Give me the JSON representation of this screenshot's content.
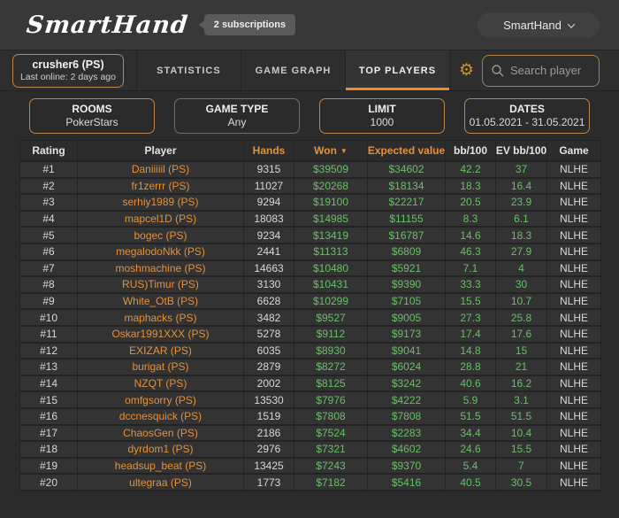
{
  "header": {
    "logo": "SmartHand",
    "subscriptions_badge": "2 subscriptions",
    "account_menu": "SmartHand"
  },
  "tabs": {
    "player_card": {
      "name": "crusher6 (PS)",
      "last_online": "Last online: 2 days ago"
    },
    "items": [
      {
        "label": "STATISTICS",
        "active": false
      },
      {
        "label": "GAME GRAPH",
        "active": false
      },
      {
        "label": "TOP PLAYERS",
        "active": true
      }
    ],
    "search_placeholder": "Search player"
  },
  "filters": [
    {
      "label": "ROOMS",
      "value": "PokerStars",
      "highlight": true
    },
    {
      "label": "GAME TYPE",
      "value": "Any",
      "highlight": false
    },
    {
      "label": "LIMIT",
      "value": "1000",
      "highlight": true
    },
    {
      "label": "DATES",
      "value": "01.05.2021 - 31.05.2021",
      "highlight": true
    }
  ],
  "table": {
    "columns": [
      "Rating",
      "Player",
      "Hands",
      "Won",
      "Expected value",
      "bb/100",
      "EV bb/100",
      "Game"
    ],
    "orange_columns": [
      "Hands",
      "Won",
      "Expected value"
    ],
    "sorted_column": "Won",
    "sort_direction": "desc",
    "rows": [
      {
        "rating": "#1",
        "player": "Daniiiiil (PS)",
        "hands": "9315",
        "won": "$39509",
        "expected_value": "$34602",
        "bb_100": "42.2",
        "ev_bb_100": "37",
        "game": "NLHE"
      },
      {
        "rating": "#2",
        "player": "fr1zerrr (PS)",
        "hands": "11027",
        "won": "$20268",
        "expected_value": "$18134",
        "bb_100": "18.3",
        "ev_bb_100": "16.4",
        "game": "NLHE"
      },
      {
        "rating": "#3",
        "player": "serhiy1989 (PS)",
        "hands": "9294",
        "won": "$19100",
        "expected_value": "$22217",
        "bb_100": "20.5",
        "ev_bb_100": "23.9",
        "game": "NLHE"
      },
      {
        "rating": "#4",
        "player": "mapcel1D (PS)",
        "hands": "18083",
        "won": "$14985",
        "expected_value": "$11155",
        "bb_100": "8.3",
        "ev_bb_100": "6.1",
        "game": "NLHE"
      },
      {
        "rating": "#5",
        "player": "bogec (PS)",
        "hands": "9234",
        "won": "$13419",
        "expected_value": "$16787",
        "bb_100": "14.6",
        "ev_bb_100": "18.3",
        "game": "NLHE"
      },
      {
        "rating": "#6",
        "player": "megalodoNkk (PS)",
        "hands": "2441",
        "won": "$11313",
        "expected_value": "$6809",
        "bb_100": "46.3",
        "ev_bb_100": "27.9",
        "game": "NLHE"
      },
      {
        "rating": "#7",
        "player": "moshmachine (PS)",
        "hands": "14663",
        "won": "$10480",
        "expected_value": "$5921",
        "bb_100": "7.1",
        "ev_bb_100": "4",
        "game": "NLHE"
      },
      {
        "rating": "#8",
        "player": "RUS)Timur (PS)",
        "hands": "3130",
        "won": "$10431",
        "expected_value": "$9390",
        "bb_100": "33.3",
        "ev_bb_100": "30",
        "game": "NLHE"
      },
      {
        "rating": "#9",
        "player": "White_OtB (PS)",
        "hands": "6628",
        "won": "$10299",
        "expected_value": "$7105",
        "bb_100": "15.5",
        "ev_bb_100": "10.7",
        "game": "NLHE"
      },
      {
        "rating": "#10",
        "player": "maphacks (PS)",
        "hands": "3482",
        "won": "$9527",
        "expected_value": "$9005",
        "bb_100": "27.3",
        "ev_bb_100": "25.8",
        "game": "NLHE"
      },
      {
        "rating": "#11",
        "player": "Oskar1991XXX (PS)",
        "hands": "5278",
        "won": "$9112",
        "expected_value": "$9173",
        "bb_100": "17.4",
        "ev_bb_100": "17.6",
        "game": "NLHE"
      },
      {
        "rating": "#12",
        "player": "EXIZAR (PS)",
        "hands": "6035",
        "won": "$8930",
        "expected_value": "$9041",
        "bb_100": "14.8",
        "ev_bb_100": "15",
        "game": "NLHE"
      },
      {
        "rating": "#13",
        "player": "burigat (PS)",
        "hands": "2879",
        "won": "$8272",
        "expected_value": "$6024",
        "bb_100": "28.8",
        "ev_bb_100": "21",
        "game": "NLHE"
      },
      {
        "rating": "#14",
        "player": "NZQT (PS)",
        "hands": "2002",
        "won": "$8125",
        "expected_value": "$3242",
        "bb_100": "40.6",
        "ev_bb_100": "16.2",
        "game": "NLHE"
      },
      {
        "rating": "#15",
        "player": "omfgsorry (PS)",
        "hands": "13530",
        "won": "$7976",
        "expected_value": "$4222",
        "bb_100": "5.9",
        "ev_bb_100": "3.1",
        "game": "NLHE"
      },
      {
        "rating": "#16",
        "player": "dccnesquick (PS)",
        "hands": "1519",
        "won": "$7808",
        "expected_value": "$7808",
        "bb_100": "51.5",
        "ev_bb_100": "51.5",
        "game": "NLHE"
      },
      {
        "rating": "#17",
        "player": "ChaosGen (PS)",
        "hands": "2186",
        "won": "$7524",
        "expected_value": "$2283",
        "bb_100": "34.4",
        "ev_bb_100": "10.4",
        "game": "NLHE"
      },
      {
        "rating": "#18",
        "player": "dyrdom1 (PS)",
        "hands": "2976",
        "won": "$7321",
        "expected_value": "$4602",
        "bb_100": "24.6",
        "ev_bb_100": "15.5",
        "game": "NLHE"
      },
      {
        "rating": "#19",
        "player": "headsup_beat (PS)",
        "hands": "13425",
        "won": "$7243",
        "expected_value": "$9370",
        "bb_100": "5.4",
        "ev_bb_100": "7",
        "game": "NLHE"
      },
      {
        "rating": "#20",
        "player": "ultegraa (PS)",
        "hands": "1773",
        "won": "$7182",
        "expected_value": "$5416",
        "bb_100": "40.5",
        "ev_bb_100": "30.5",
        "game": "NLHE"
      }
    ]
  },
  "colors": {
    "accent_orange": "#e3923a",
    "positive_green": "#6abf69",
    "tab_underline": "#f28a1d",
    "filter_border_active": "#bd8751"
  }
}
